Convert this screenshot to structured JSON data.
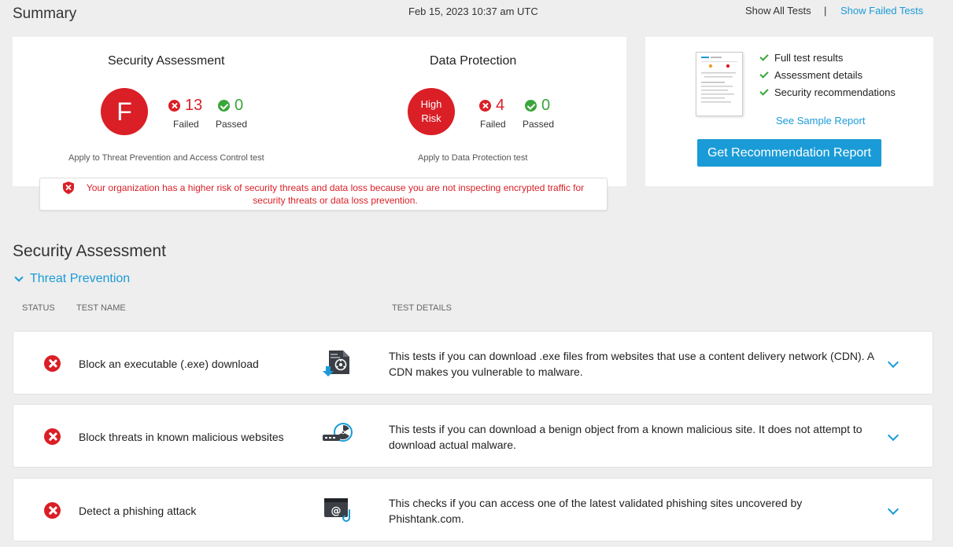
{
  "header": {
    "title": "Summary",
    "timestamp": "Feb 15, 2023 10:37 am UTC",
    "show_all": "Show All Tests",
    "separator": "|",
    "show_failed": "Show Failed Tests"
  },
  "summary": {
    "security": {
      "title": "Security Assessment",
      "grade": "F",
      "failed": "13",
      "failed_label": "Failed",
      "passed": "0",
      "passed_label": "Passed",
      "note": "Apply to Threat Prevention and Access Control test"
    },
    "data_protection": {
      "title": "Data Protection",
      "grade_line1": "High",
      "grade_line2": "Risk",
      "failed": "4",
      "failed_label": "Failed",
      "passed": "0",
      "passed_label": "Passed",
      "note": "Apply to Data Protection test"
    },
    "warning_line1": "Your organization has a higher risk of security threats and data loss because you are not inspecting encrypted traffic for",
    "warning_line2": "security threats or data loss prevention."
  },
  "report": {
    "features": [
      "Full test results",
      "Assessment details",
      "Security recommendations"
    ],
    "sample_link": "See Sample Report",
    "button": "Get Recommendation Report"
  },
  "section": {
    "title": "Security Assessment",
    "subsection": "Threat Prevention",
    "columns": {
      "status": "STATUS",
      "name": "TEST NAME",
      "details": "TEST DETAILS"
    }
  },
  "tests": [
    {
      "name": "Block an executable (.exe) download",
      "details": "This tests if you can download .exe files from websites that use a content delivery network (CDN). A CDN makes you vulnerable to malware.",
      "icon": "biohazard-download-icon"
    },
    {
      "name": "Block threats in known malicious websites",
      "details": "This tests if you can download a benign object from a known malicious site. It does not attempt to download actual malware.",
      "icon": "radiation-site-icon"
    },
    {
      "name": "Detect a phishing attack",
      "details": "This checks if you can access one of the latest validated phishing sites uncovered by Phishtank.com.",
      "icon": "phishing-email-icon"
    }
  ],
  "colors": {
    "accent": "#1a9bd7",
    "fail": "#da1f26",
    "pass": "#3aa53a",
    "background": "#eeeeee"
  }
}
